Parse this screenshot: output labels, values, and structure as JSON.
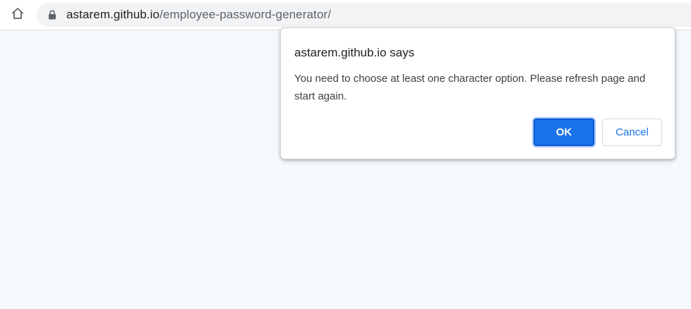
{
  "browser": {
    "home_icon": "home-icon",
    "lock_icon": "lock-icon",
    "url_host": "astarem.github.io",
    "url_path": "/employee-password-generator/"
  },
  "dialog": {
    "title": "astarem.github.io says",
    "message": "You need to choose at least one character option. Please refresh page and start again.",
    "ok_label": "OK",
    "cancel_label": "Cancel"
  },
  "colors": {
    "page_background": "#f6f9fc",
    "accent": "#1a73e8"
  }
}
